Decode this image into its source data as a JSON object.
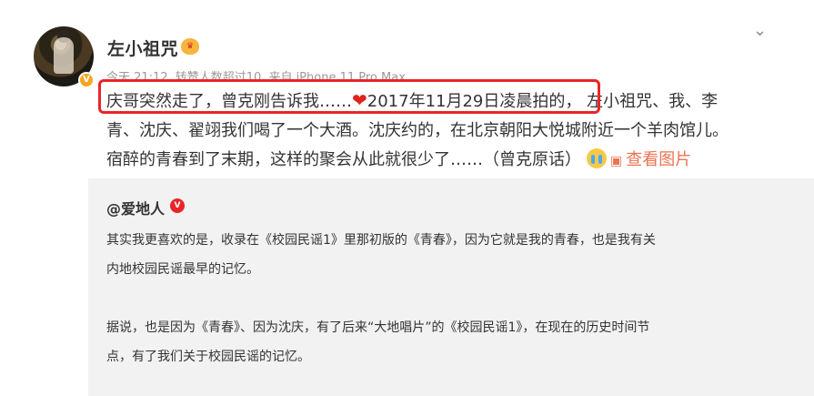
{
  "user": {
    "name": "左小祖咒",
    "verified_mark": "V",
    "crown_label": "♛"
  },
  "meta": {
    "time": "今天 21:12",
    "reposts": "转赞人数超过10",
    "source": "来自 iPhone 11 Pro Max"
  },
  "menu_icon": "chevron-down-icon",
  "post": {
    "line1_part1": "庆哥突然走了，曾克刚告诉我……",
    "heart": "❤",
    "line1_part2": "2017年11月29日凌晨拍的，",
    "line1_part3": "左小祖咒、我、李",
    "line2": "青、沈庆、翟翊我们喝了一个大酒。沈庆约的，在北京朝阳大悦城附近一个羊肉馆儿。",
    "line3": "宿醉的青春到了末期，这样的聚会从此就很少了……（曾克原话）",
    "view_images": "查看图片"
  },
  "repost": {
    "user": "@爱地人",
    "badge": "V",
    "para1_line1": "其实我更喜欢的是，收录在《校园民谣1》里那初版的《青春》，因为它就是我的青春，也是我有关",
    "para1_line2": "内地校园民谣最早的记忆。",
    "para2_line1": "据说，也是因为《青春》、因为沈庆，有了后来“大地唱片”的《校园民谣1》，在现在的历史时间节",
    "para2_line2": "点，有了我们关于校园民谣的记忆。"
  },
  "colors": {
    "highlight_border": "#e8262a",
    "link": "#eb7350",
    "repost_bg": "#f2f2f2",
    "meta_text": "#999999"
  }
}
